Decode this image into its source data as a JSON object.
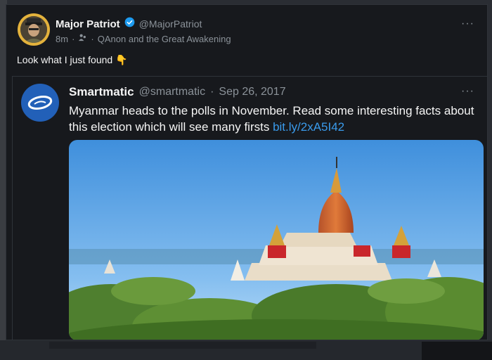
{
  "tweet": {
    "author_name": "Major Patriot",
    "author_handle": "@MajorPatriot",
    "time": "8m",
    "community": "QAnon and the Great Awakening",
    "text": "Look what I just found",
    "emoji": "👇",
    "more": "···"
  },
  "quoted_tweet": {
    "author_name": "Smartmatic",
    "author_handle": "@smartmatic",
    "date_sep": "·",
    "date": "Sep 26, 2017",
    "text": "Myanmar heads to the polls in November. Read some interesting facts about this election which will see many firsts",
    "link": "bit.ly/2xA5I42",
    "more": "···"
  },
  "colors": {
    "background": "#17191d",
    "text": "#f5f5f5",
    "muted": "#8b9299",
    "link": "#3a9bec",
    "verified": "#1d9bf0",
    "avatar_ring": "#e3b23c",
    "smartmatic_blue": "#2260b8"
  },
  "icons": {
    "verified": "verified-badge-icon",
    "community": "community-icon",
    "more": "more-options-icon",
    "smartmatic_logo": "smartmatic-logo-icon"
  }
}
